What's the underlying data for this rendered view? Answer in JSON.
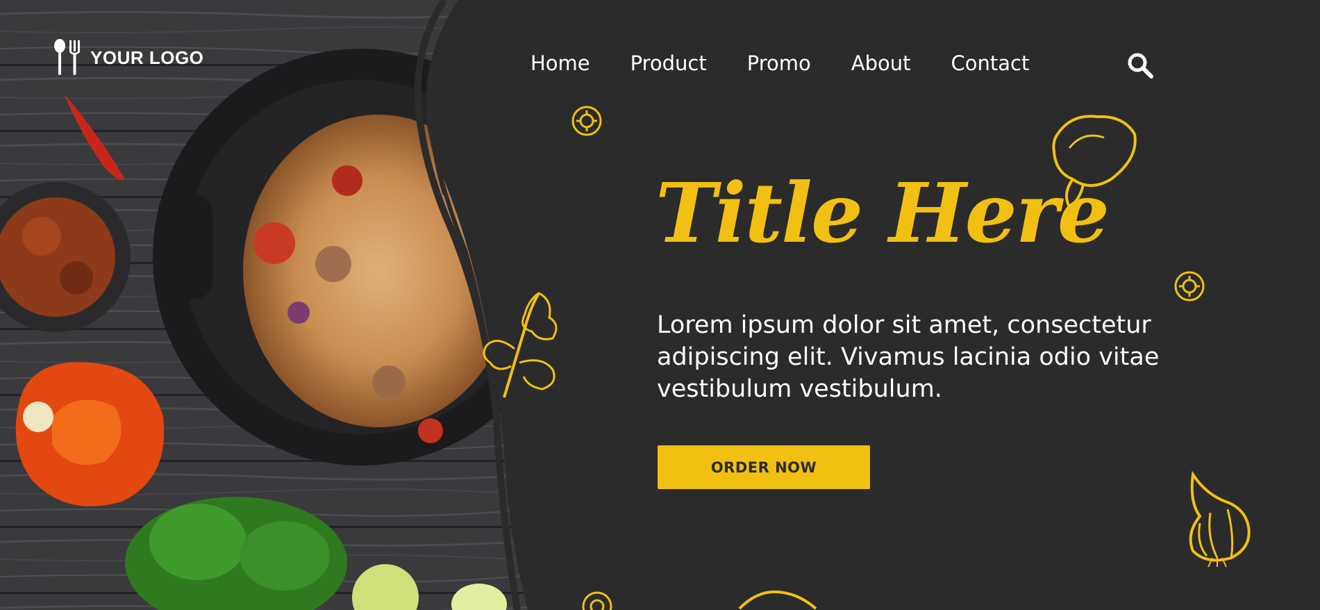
{
  "brand": {
    "logo_text": "YOUR LOGO",
    "logo_icon": "fork-spoon-icon"
  },
  "nav": {
    "items": [
      {
        "label": "Home"
      },
      {
        "label": "Product"
      },
      {
        "label": "Promo"
      },
      {
        "label": "About"
      },
      {
        "label": "Contact"
      }
    ],
    "search_icon": "search-icon"
  },
  "hero": {
    "title": "Title Here",
    "body": "Lorem ipsum dolor sit amet, consectetur adipiscing elit. Vivamus lacinia odio vitae vestibulum vestibulum.",
    "cta_label": "ORDER NOW"
  },
  "colors": {
    "accent": "#f2c012",
    "panel": "#2b2b2b",
    "text": "#ffffff"
  }
}
